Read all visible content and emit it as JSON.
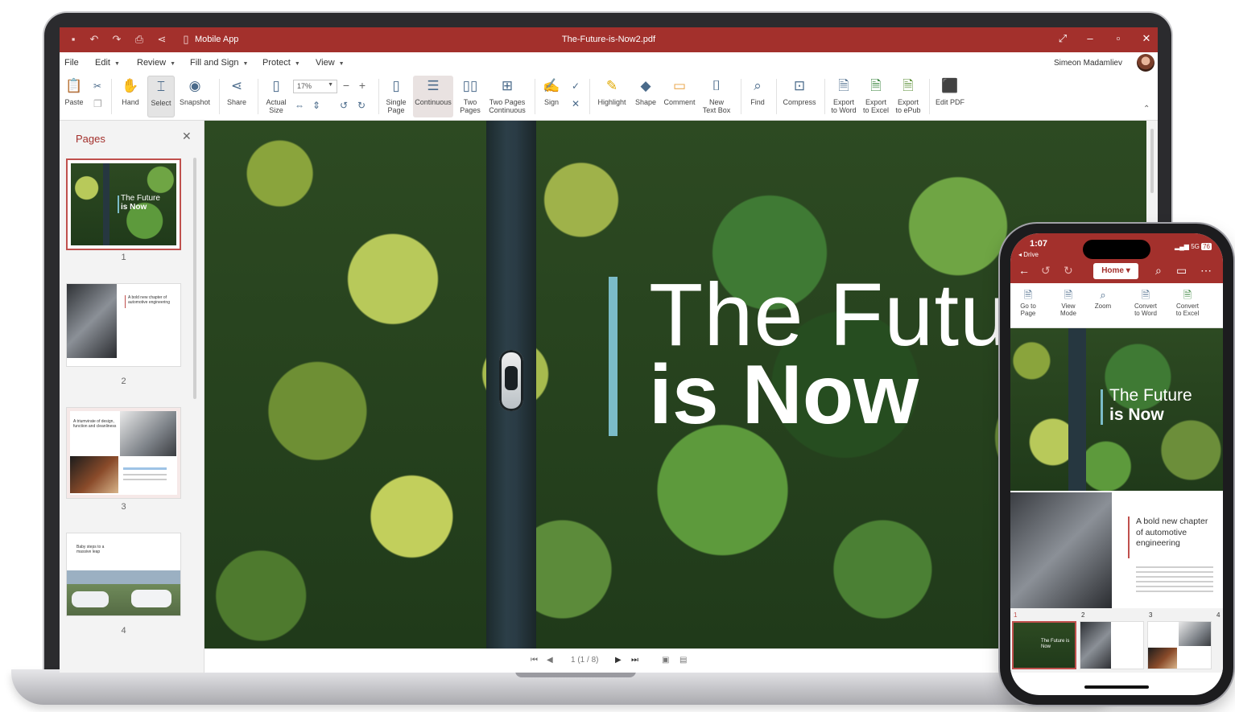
{
  "window": {
    "app_label": "Mobile App",
    "title": "The-Future-is-Now2.pdf"
  },
  "menu": {
    "file": "File",
    "edit": "Edit",
    "review": "Review",
    "fill_sign": "Fill and Sign",
    "protect": "Protect",
    "view": "View",
    "user": "Simeon Madamliev"
  },
  "ribbon": {
    "paste": "Paste",
    "hand": "Hand",
    "select": "Select",
    "snapshot": "Snapshot",
    "share": "Share",
    "actual_size_1": "Actual",
    "actual_size_2": "Size",
    "zoom_value": "17%",
    "single_page_1": "Single",
    "single_page_2": "Page",
    "continuous": "Continuous",
    "two_pages_1": "Two",
    "two_pages_2": "Pages",
    "two_pages_cont_1": "Two Pages",
    "two_pages_cont_2": "Continuous",
    "sign": "Sign",
    "highlight": "Highlight",
    "shape": "Shape",
    "comment": "Comment",
    "new_text_box_1": "New",
    "new_text_box_2": "Text Box",
    "find": "Find",
    "compress": "Compress",
    "export_word_1": "Export",
    "export_word_2": "to Word",
    "export_excel_1": "Export",
    "export_excel_2": "to Excel",
    "export_epub_1": "Export",
    "export_epub_2": "to ePub",
    "edit_pdf": "Edit PDF"
  },
  "pages_panel": {
    "title": "Pages",
    "pages": [
      {
        "number": "1",
        "title_1": "The Future",
        "title_2": "is Now"
      },
      {
        "number": "2",
        "text": "A bold new chapter of automotive engineering"
      },
      {
        "number": "3",
        "text": "A triumvirate of design, function and cleanliness"
      },
      {
        "number": "4",
        "text": "Baby steps to a massive leap"
      }
    ]
  },
  "document": {
    "headline_1": "The Future",
    "headline_2": "is Now"
  },
  "statusbar": {
    "page_indicator": "1 (1 / 8)"
  },
  "phone": {
    "time": "1:07",
    "back_label": "◂ Drive",
    "signal": "5G",
    "battery": "76",
    "tab": "Home",
    "tools": {
      "goto_1": "Go to",
      "goto_2": "Page",
      "view_mode_1": "View",
      "view_mode_2": "Mode",
      "zoom": "Zoom",
      "convert_word_1": "Convert",
      "convert_word_2": "to Word",
      "convert_excel_1": "Convert",
      "convert_excel_2": "to Excel"
    },
    "page1_title_1": "The Future",
    "page1_title_2": "is Now",
    "page2_title": "A bold new chapter of automotive engineering",
    "strip_numbers": [
      "1",
      "2",
      "3",
      "4"
    ],
    "strip_thumb_1": "The Future is Now"
  },
  "colors": {
    "brand": "#a3302c",
    "accent": "#7bbcc8"
  }
}
